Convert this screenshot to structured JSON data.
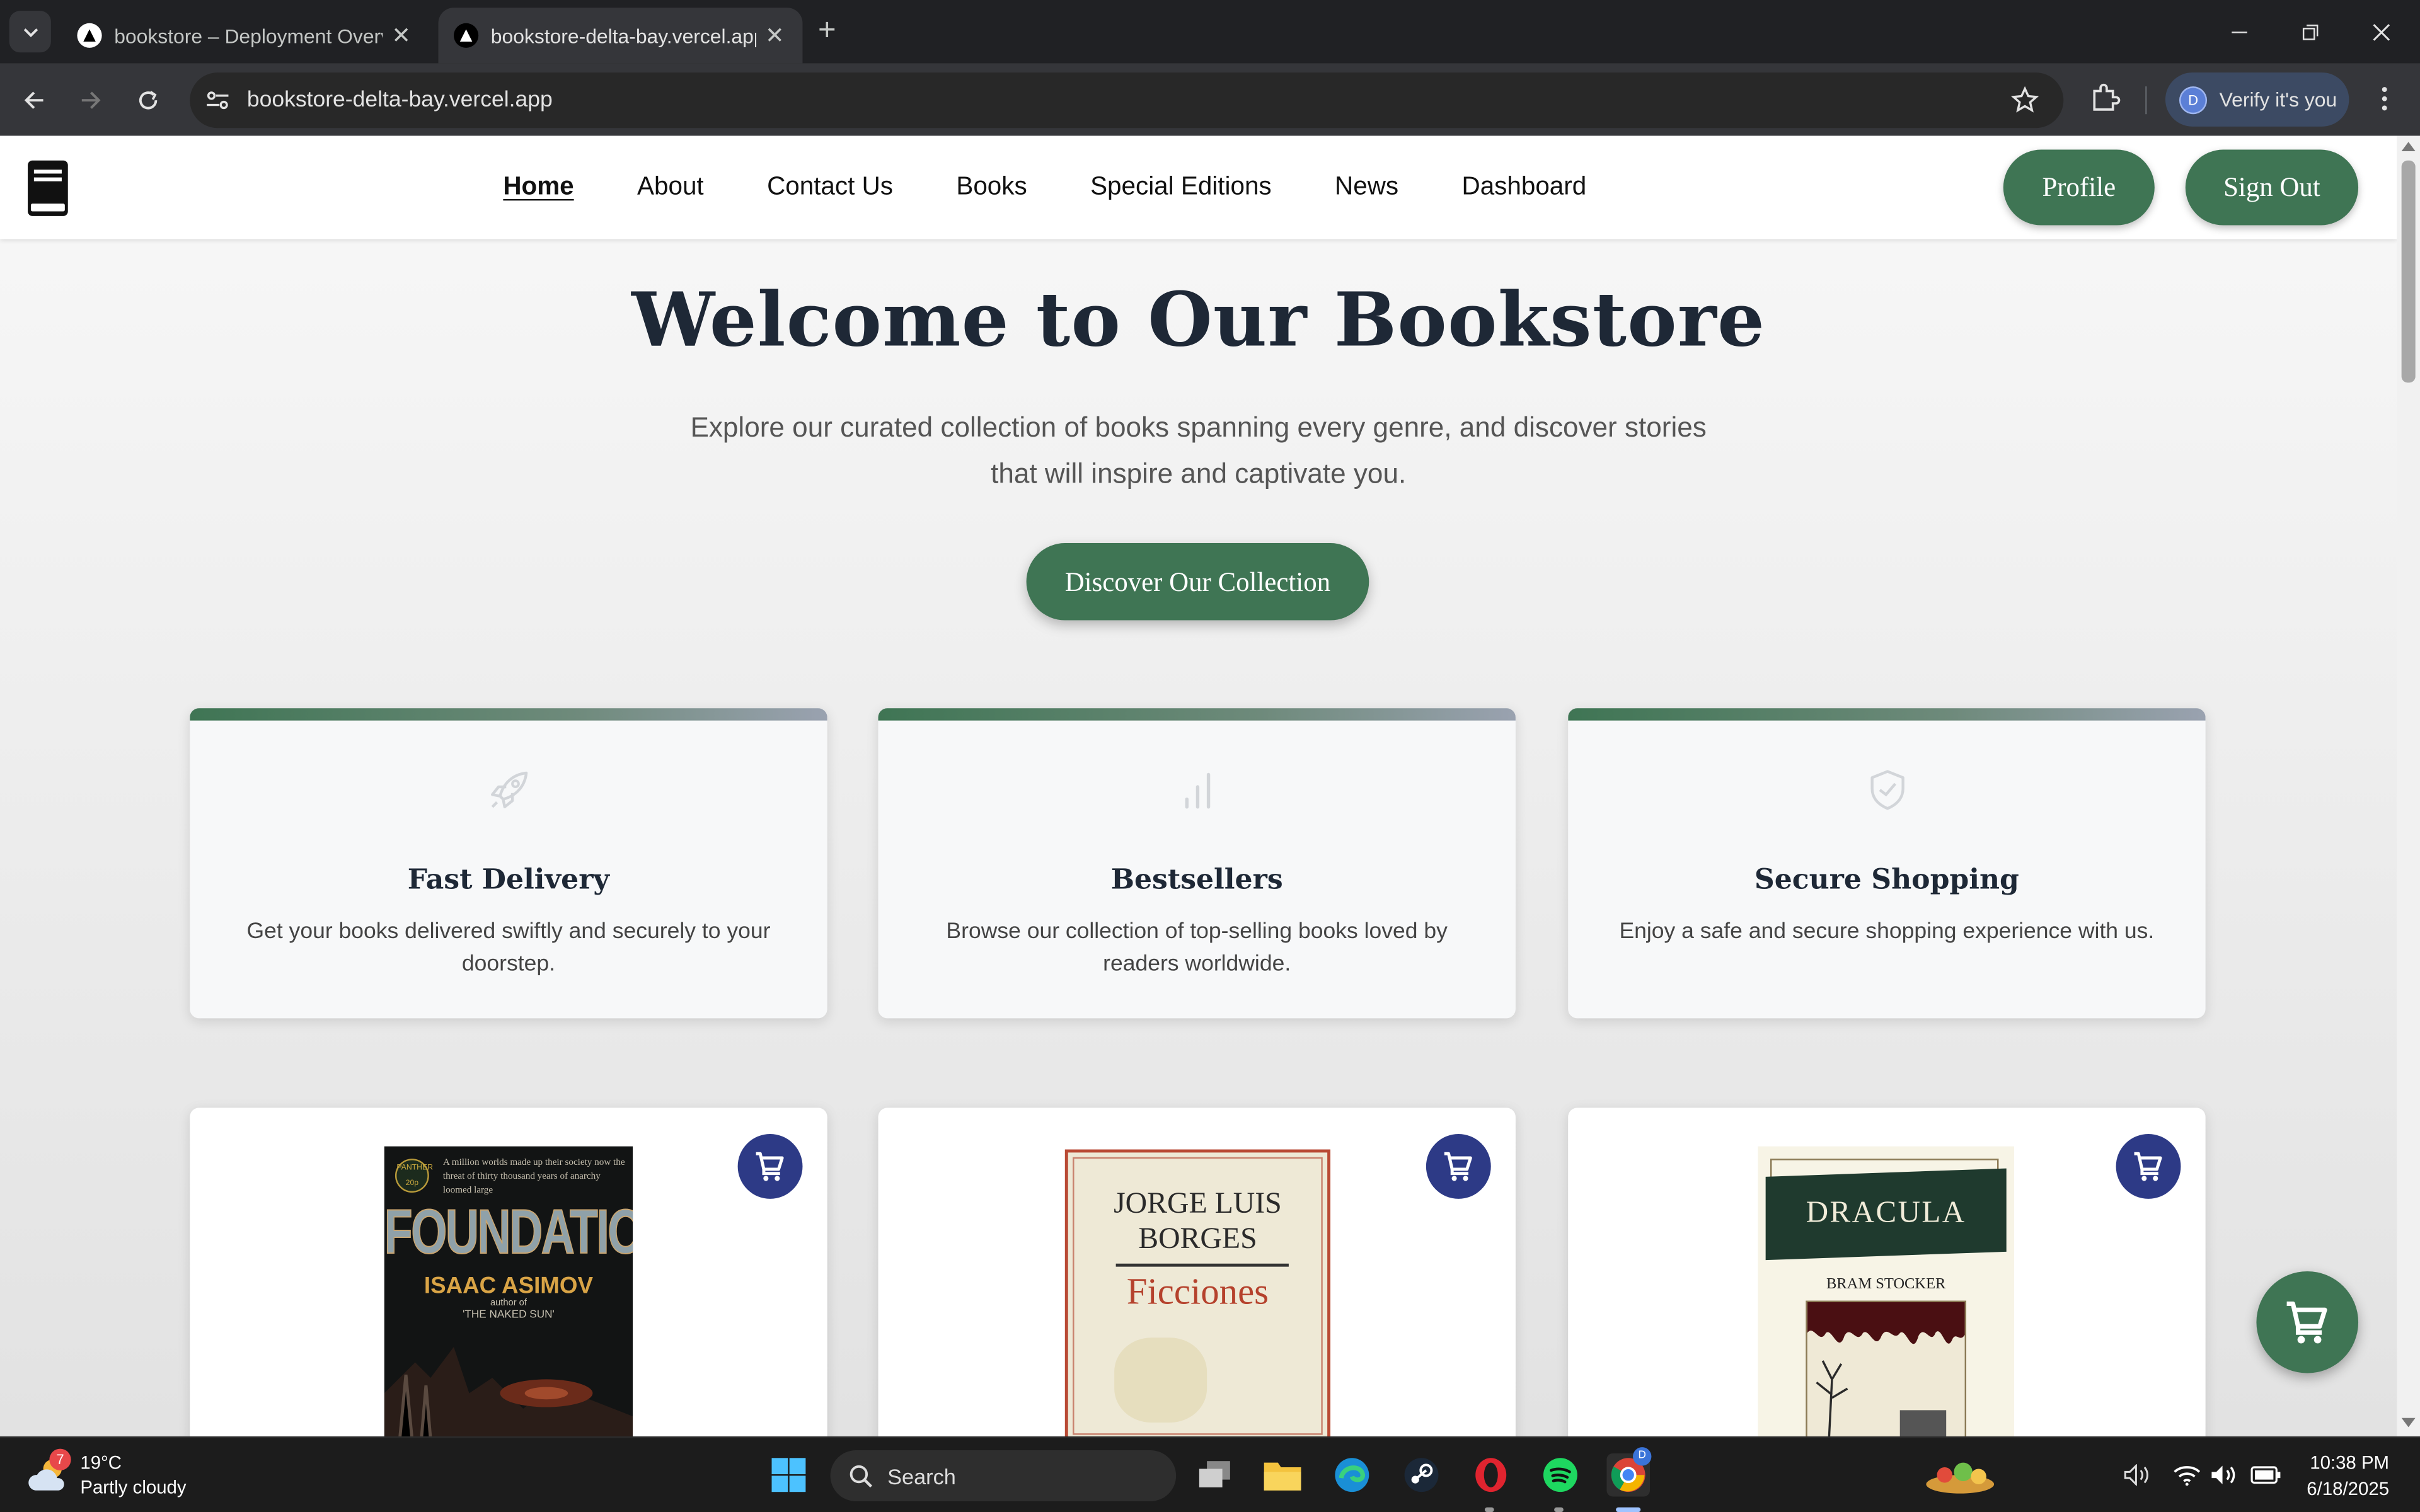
{
  "browser": {
    "tabs": [
      {
        "title": "bookstore – Deployment Overv",
        "active": false
      },
      {
        "title": "bookstore-delta-bay.vercel.app",
        "active": true
      }
    ],
    "url": "bookstore-delta-bay.vercel.app",
    "verify_label": "Verify it's you",
    "profile_initial": "D"
  },
  "site": {
    "nav": [
      "Home",
      "About",
      "Contact Us",
      "Books",
      "Special Editions",
      "News",
      "Dashboard"
    ],
    "active_nav": "Home",
    "profile_label": "Profile",
    "signout_label": "Sign Out",
    "accent_color": "#3f7554",
    "cart_color": "#2d3a86"
  },
  "hero": {
    "title": "Welcome to Our Bookstore",
    "subtitle": "Explore our curated collection of books spanning every genre, and discover stories that will inspire and captivate you.",
    "cta_label": "Discover Our Collection"
  },
  "features": [
    {
      "icon": "rocket-icon",
      "title": "Fast Delivery",
      "text": "Get your books delivered swiftly and securely to your doorstep."
    },
    {
      "icon": "bar-chart-icon",
      "title": "Bestsellers",
      "text": "Browse our collection of top-selling books loved by readers worldwide."
    },
    {
      "icon": "shield-check-icon",
      "title": "Secure Shopping",
      "text": "Enjoy a safe and secure shopping experience with us."
    }
  ],
  "books": [
    {
      "cover_top": "A million worlds made up their society now the threat of thirty thousand years of anarchy loomed large",
      "badge": "PANTHER 20p",
      "title": "FOUNDATION",
      "author": "ISAAC ASIMOV",
      "byline_1": "author of",
      "byline_2": "'THE NAKED SUN'"
    },
    {
      "author_1": "JORGE LUIS",
      "author_2": "BORGES",
      "title": "Ficciones"
    },
    {
      "title": "DRACULA",
      "author": "BRAM STOCKER"
    }
  ],
  "taskbar": {
    "weather_temp": "19°C",
    "weather_desc": "Partly cloudy",
    "weather_badge": "7",
    "search_placeholder": "Search",
    "time": "10:38 PM",
    "date": "6/18/2025"
  }
}
